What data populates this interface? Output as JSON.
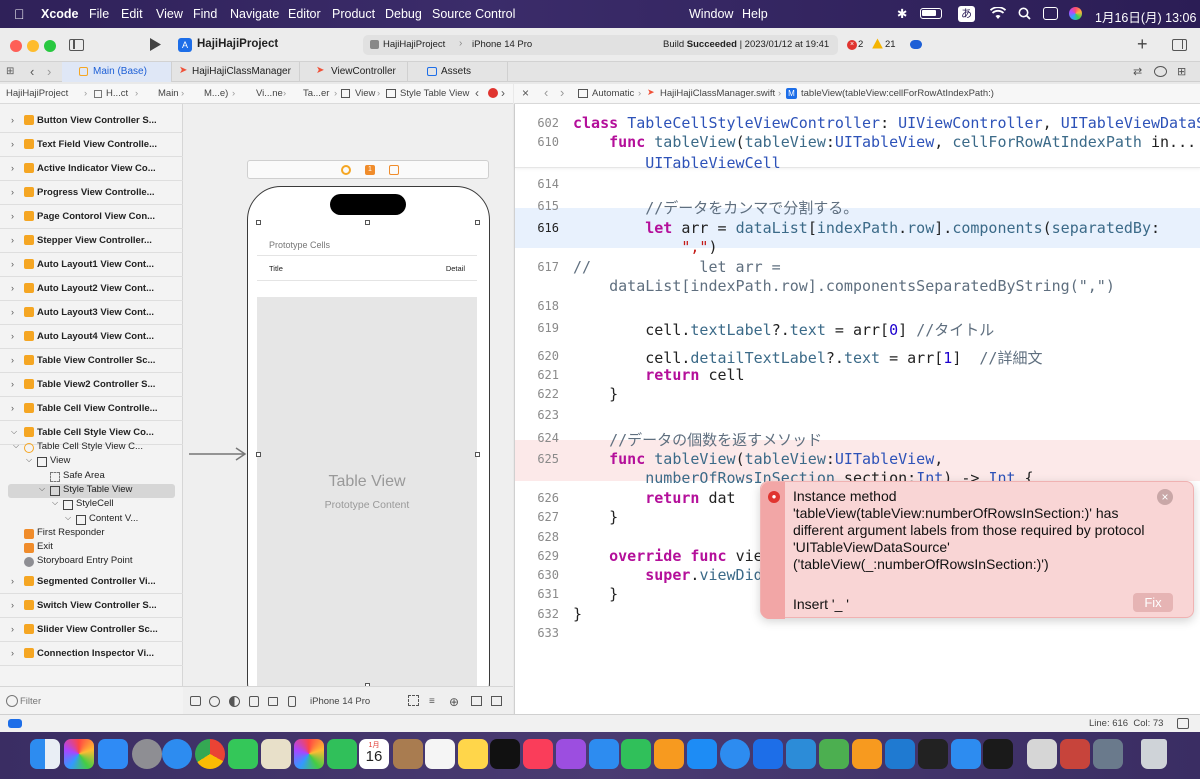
{
  "menubar": {
    "app": "Xcode",
    "items": [
      "File",
      "Edit",
      "View",
      "Find",
      "Navigate",
      "Editor",
      "Product",
      "Debug",
      "Source Control",
      "Window",
      "Help"
    ],
    "input_method": "あ",
    "datetime": "1月16日(月)  13:06"
  },
  "toolbar": {
    "project": "HajiHajiProject",
    "scheme": "HajiHajiProject",
    "device": "iPhone 14 Pro",
    "build_prefix": "Build ",
    "build_status": "Succeeded",
    "build_date": " | 2023/01/12 at 19:41",
    "errors": "2",
    "warnings": "21"
  },
  "tabs": [
    {
      "label": "Main (Base)"
    },
    {
      "label": "HajiHajiClassManager"
    },
    {
      "label": "ViewController"
    },
    {
      "label": "Assets"
    }
  ],
  "jump_left": [
    "HajiHajiProject",
    "H...ct",
    "Main",
    "M...e)",
    "Vi...ne",
    "Ta...er",
    "View",
    "Style Table View"
  ],
  "jump_right": [
    "Automatic",
    "HajiHajiClassManager.swift",
    "tableView(tableView:cellForRowAtIndexPath:)"
  ],
  "navigator": {
    "scenes": [
      "Button View Controller S...",
      "Text Field View Controlle...",
      "Active Indicator View Co...",
      "Progress View Controlle...",
      "Page Contorol View Con...",
      "Stepper View Controller...",
      "Auto Layout1 View Cont...",
      "Auto Layout2 View Cont...",
      "Auto Layout3 View Cont...",
      "Auto Layout4 View Cont...",
      "Table View Controller Sc...",
      "Table View2 Controller S...",
      "Table Cell View Controlle...",
      "Table Cell Style View Co..."
    ],
    "tree": [
      "Table Cell Style View C...",
      "View",
      "Safe Area",
      "Style Table View",
      "StyleCell",
      "Content V...",
      "First Responder",
      "Exit",
      "Storyboard Entry Point"
    ],
    "scenes_after": [
      "Segmented Controller Vi...",
      "Switch View Controller S...",
      "Slider View Controller Sc...",
      "Connection Inspector Vi..."
    ],
    "filter_placeholder": "Filter"
  },
  "canvas": {
    "prototype_cells": "Prototype Cells",
    "cell_title": "Title",
    "cell_detail": "Detail",
    "table_view": "Table View",
    "prototype_content": "Prototype Content",
    "device": "iPhone 14 Pro"
  },
  "editor": {
    "lines": [
      {
        "n": "602",
        "parts": [
          [
            "kw",
            "class "
          ],
          [
            "ty",
            "TableCellStyleViewController"
          ],
          [
            "",
            ": "
          ],
          [
            "ty",
            "UIViewController"
          ],
          [
            "",
            ", "
          ],
          [
            "ty",
            "UITableViewDataS..."
          ]
        ]
      },
      {
        "n": "610",
        "parts": [
          [
            "",
            "    "
          ],
          [
            "kw",
            "func "
          ],
          [
            "fn",
            "tableView"
          ],
          [
            "",
            "("
          ],
          [
            "fn",
            "tableView"
          ],
          [
            "",
            ":"
          ],
          [
            "ty",
            "UITableView"
          ],
          [
            "",
            ", "
          ],
          [
            "fn",
            "cellForRowAtIndexPath"
          ],
          [
            "",
            " in..."
          ]
        ]
      },
      {
        "n": "",
        "parts": [
          [
            "",
            "        "
          ],
          [
            "ty",
            "UITableViewCell"
          ]
        ]
      },
      {
        "n": "614",
        "parts": []
      },
      {
        "n": "615",
        "parts": [
          [
            "cm",
            "        //データをカンマで分割する。"
          ]
        ]
      },
      {
        "n": "616",
        "parts": [
          [
            "",
            "        "
          ],
          [
            "kw",
            "let "
          ],
          [
            "",
            "arr = "
          ],
          [
            "fn",
            "dataList"
          ],
          [
            "",
            "["
          ],
          [
            "fn",
            "indexPath"
          ],
          [
            "",
            "."
          ],
          [
            "fn",
            "row"
          ],
          [
            "",
            "]."
          ],
          [
            "fn",
            "components"
          ],
          [
            "",
            "("
          ],
          [
            "fn",
            "separatedBy"
          ],
          [
            "",
            ":"
          ]
        ]
      },
      {
        "n": "",
        "parts": [
          [
            "st",
            "            \",\""
          ],
          [
            "",
            ")"
          ]
        ]
      },
      {
        "n": "617",
        "parts": [
          [
            "cm",
            "//            let arr ="
          ]
        ]
      },
      {
        "n": "",
        "parts": [
          [
            "cm",
            "    dataList[indexPath.row].componentsSeparatedByString(\",\")"
          ]
        ]
      },
      {
        "n": "618",
        "parts": []
      },
      {
        "n": "619",
        "parts": [
          [
            "",
            "        cell."
          ],
          [
            "fn",
            "textLabel"
          ],
          [
            "",
            "?."
          ],
          [
            "fn",
            "text"
          ],
          [
            "",
            " = arr["
          ],
          [
            "nm",
            "0"
          ],
          [
            "",
            "] "
          ],
          [
            "cm",
            "//タイトル"
          ]
        ]
      },
      {
        "n": "620",
        "parts": [
          [
            "",
            "        cell."
          ],
          [
            "fn",
            "detailTextLabel"
          ],
          [
            "",
            "?."
          ],
          [
            "fn",
            "text"
          ],
          [
            "",
            " = arr["
          ],
          [
            "nm",
            "1"
          ],
          [
            "",
            "]  "
          ],
          [
            "cm",
            "//詳細文"
          ]
        ]
      },
      {
        "n": "621",
        "parts": [
          [
            "",
            "        "
          ],
          [
            "kw",
            "return "
          ],
          [
            "",
            "cell"
          ]
        ]
      },
      {
        "n": "622",
        "parts": [
          [
            "",
            "    }"
          ]
        ]
      },
      {
        "n": "623",
        "parts": []
      },
      {
        "n": "624",
        "parts": [
          [
            "cm",
            "    //データの個数を返すメソッド"
          ]
        ]
      },
      {
        "n": "625",
        "parts": [
          [
            "",
            "    "
          ],
          [
            "kw",
            "func "
          ],
          [
            "fn",
            "tableView"
          ],
          [
            "",
            "("
          ],
          [
            "fn",
            "tableView"
          ],
          [
            "",
            ":"
          ],
          [
            "ty",
            "UITableView"
          ],
          [
            "",
            ","
          ]
        ]
      },
      {
        "n": "",
        "parts": [
          [
            "",
            "        "
          ],
          [
            "fn",
            "numberOfRowsInSection"
          ],
          [
            "",
            " section:"
          ],
          [
            "ty",
            "Int"
          ],
          [
            "",
            ") -> "
          ],
          [
            "ty",
            "Int"
          ],
          [
            "",
            " {"
          ]
        ]
      },
      {
        "n": "626",
        "parts": [
          [
            "",
            "        "
          ],
          [
            "kw",
            "return "
          ],
          [
            "",
            "dat"
          ]
        ]
      },
      {
        "n": "627",
        "parts": [
          [
            "",
            "    }"
          ]
        ]
      },
      {
        "n": "628",
        "parts": []
      },
      {
        "n": "629",
        "parts": [
          [
            "",
            "    "
          ],
          [
            "kw",
            "override func "
          ],
          [
            "",
            "view"
          ]
        ]
      },
      {
        "n": "630",
        "parts": [
          [
            "",
            "        "
          ],
          [
            "kw",
            "super"
          ],
          [
            "",
            "."
          ],
          [
            "fn",
            "viewDidL"
          ]
        ]
      },
      {
        "n": "631",
        "parts": [
          [
            "",
            "    }"
          ]
        ]
      },
      {
        "n": "632",
        "parts": [
          [
            "",
            "}"
          ]
        ]
      },
      {
        "n": "633",
        "parts": []
      }
    ]
  },
  "error_popup": {
    "message": "Instance method 'tableView(tableView:numberOfRowsInSection:)' has different argument labels from those required by protocol 'UITableViewDataSource' ('tableView(_:numberOfRowsInSection:)')",
    "fix_text": "Insert '_ '",
    "fix_button": "Fix"
  },
  "statusbar": {
    "position": "Line: 616  Col: 73"
  },
  "colors": {
    "accent": "#1d6ee8",
    "error_bg": "#f7c8c8",
    "error_line": "#fce9e9",
    "current_line": "#e8f1fd"
  },
  "dock": {
    "calendar_month": "1月",
    "calendar_day": "16"
  }
}
